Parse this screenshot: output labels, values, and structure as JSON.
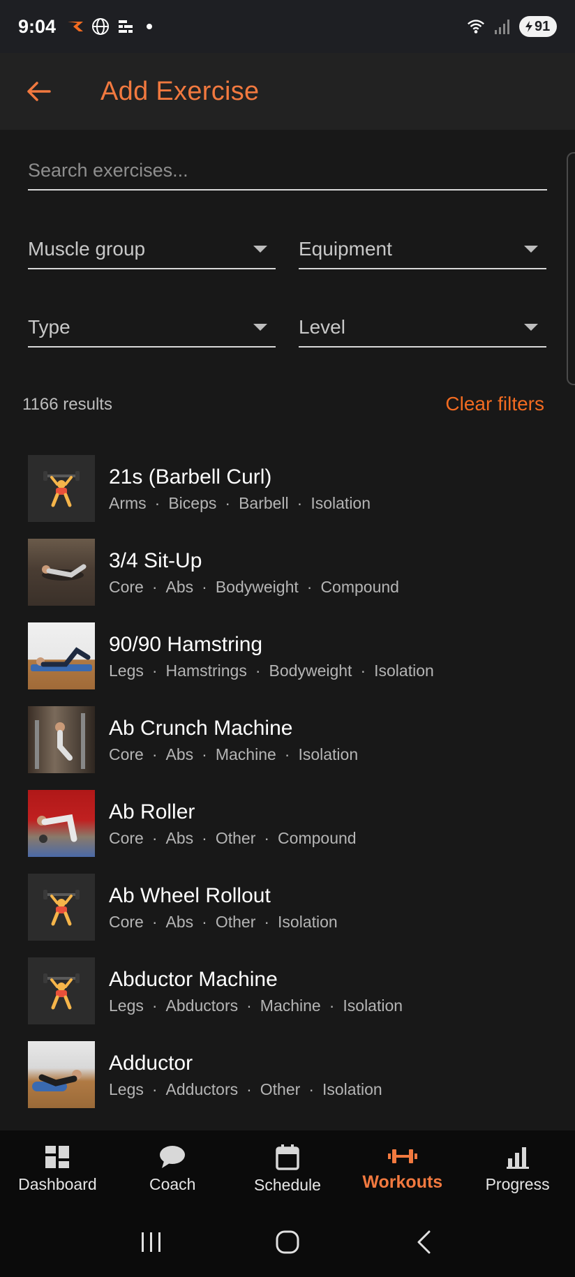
{
  "status_bar": {
    "time": "9:04",
    "battery": "91",
    "icons_left": [
      "strava-icon",
      "globe-icon",
      "grid-app-icon",
      "notification-dot"
    ],
    "icons_right": [
      "wifi-icon",
      "signal-icon",
      "battery-icon"
    ]
  },
  "app_bar": {
    "title": "Add Exercise",
    "accent_color": "#f2793f"
  },
  "search": {
    "placeholder": "Search exercises...",
    "value": ""
  },
  "filters": {
    "muscle_group": "Muscle group",
    "equipment": "Equipment",
    "type": "Type",
    "level": "Level"
  },
  "results": {
    "count_text": "1166 results",
    "clear_label": "Clear filters"
  },
  "exercises": [
    {
      "name": "21s (Barbell Curl)",
      "thumb": "weightlifter-emoji",
      "tags": [
        "Arms",
        "Biceps",
        "Barbell",
        "Isolation"
      ]
    },
    {
      "name": "3/4 Sit-Up",
      "thumb": "photo",
      "tags": [
        "Core",
        "Abs",
        "Bodyweight",
        "Compound"
      ]
    },
    {
      "name": "90/90 Hamstring",
      "thumb": "photo",
      "tags": [
        "Legs",
        "Hamstrings",
        "Bodyweight",
        "Isolation"
      ]
    },
    {
      "name": "Ab Crunch Machine",
      "thumb": "photo",
      "tags": [
        "Core",
        "Abs",
        "Machine",
        "Isolation"
      ]
    },
    {
      "name": "Ab Roller",
      "thumb": "photo",
      "tags": [
        "Core",
        "Abs",
        "Other",
        "Compound"
      ]
    },
    {
      "name": "Ab Wheel Rollout",
      "thumb": "weightlifter-emoji",
      "tags": [
        "Core",
        "Abs",
        "Other",
        "Isolation"
      ]
    },
    {
      "name": "Abductor Machine",
      "thumb": "weightlifter-emoji",
      "tags": [
        "Legs",
        "Abductors",
        "Machine",
        "Isolation"
      ]
    },
    {
      "name": "Adductor",
      "thumb": "photo",
      "tags": [
        "Legs",
        "Adductors",
        "Other",
        "Isolation"
      ]
    }
  ],
  "bottom_nav": {
    "items": [
      {
        "label": "Dashboard",
        "icon": "dashboard-icon",
        "active": false
      },
      {
        "label": "Coach",
        "icon": "chat-bubble-icon",
        "active": false
      },
      {
        "label": "Schedule",
        "icon": "calendar-icon",
        "active": false
      },
      {
        "label": "Workouts",
        "icon": "dumbbell-icon",
        "active": true
      },
      {
        "label": "Progress",
        "icon": "bar-chart-icon",
        "active": false
      }
    ]
  },
  "system_nav": [
    "recent-apps-icon",
    "home-icon",
    "back-icon"
  ]
}
